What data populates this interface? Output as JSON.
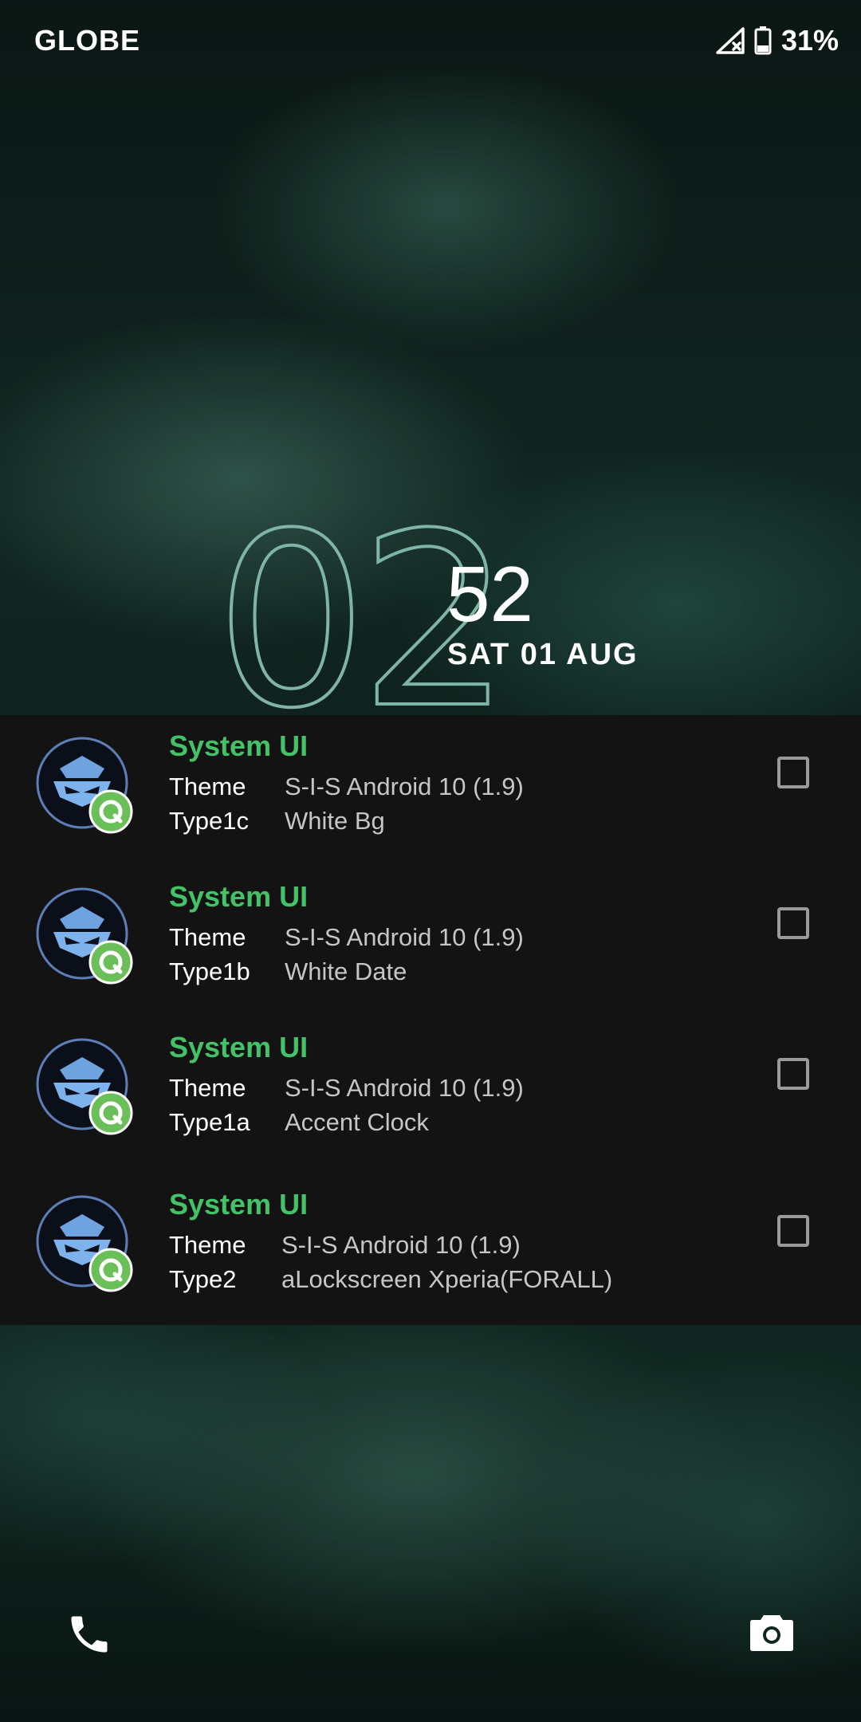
{
  "status_bar": {
    "carrier": "GLOBE",
    "battery_percent": "31%",
    "icons": [
      "signal-no-service-icon",
      "battery-icon"
    ]
  },
  "clock": {
    "hours": "02",
    "minutes": "52",
    "date": "SAT 01 AUG"
  },
  "notifications": [
    {
      "title": "System UI",
      "row1_key": "Theme",
      "row1_value": "S-I-S Android 10 (1.9)",
      "row2_key": "Type1c",
      "row2_value": "White Bg",
      "checked": false
    },
    {
      "title": "System UI",
      "row1_key": "Theme",
      "row1_value": "S-I-S Android 10 (1.9)",
      "row2_key": "Type1b",
      "row2_value": "White Date",
      "checked": false
    },
    {
      "title": "System UI",
      "row1_key": "Theme",
      "row1_value": "S-I-S Android 10 (1.9)",
      "row2_key": "Type1a",
      "row2_value": "Accent Clock",
      "checked": false
    },
    {
      "title": "System UI",
      "row1_key": "Theme",
      "row1_value": "S-I-S Android 10 (1.9)",
      "row2_key": "Type2",
      "row2_value": "aLockscreen Xperia(FORALL)",
      "checked": false
    }
  ],
  "shortcuts": {
    "left_icon": "phone-icon",
    "right_icon": "camera-icon"
  },
  "colors": {
    "title_green": "#43c268",
    "clock_outline": "#7fb5a6",
    "panel_bg": "#131313"
  }
}
